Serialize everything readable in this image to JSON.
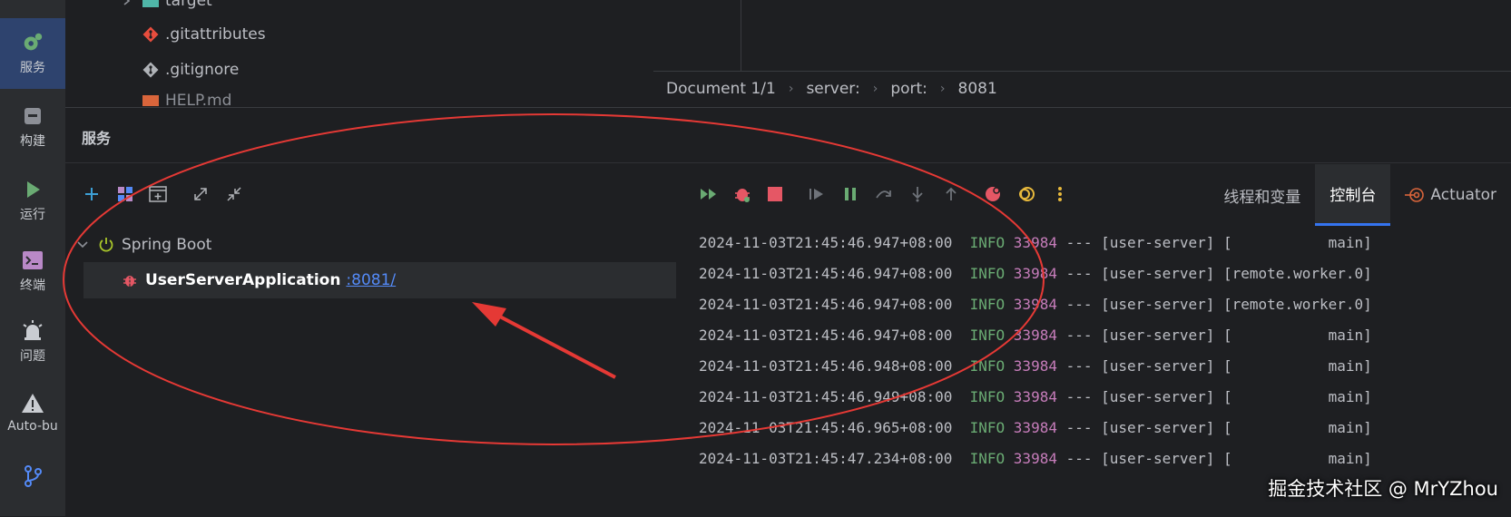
{
  "left_strip": [
    {
      "label": "服务",
      "icon": "gear-icon",
      "active": true
    },
    {
      "label": "构建",
      "icon": "build-icon"
    },
    {
      "label": "运行",
      "icon": "run-icon"
    },
    {
      "label": "终端",
      "icon": "terminal-icon"
    },
    {
      "label": "问题",
      "icon": "problems-icon"
    },
    {
      "label": "Auto-bu",
      "icon": "warning-icon"
    },
    {
      "label": "",
      "icon": "git-branch-icon"
    }
  ],
  "project_tree": [
    {
      "label": "target",
      "icon": "folder-icon"
    },
    {
      "label": ".gitattributes",
      "icon": "git-icon"
    },
    {
      "label": ".gitignore",
      "icon": "git-icon"
    },
    {
      "label": "HELP.md",
      "icon": "markdown-icon"
    }
  ],
  "breadcrumb": [
    "Document 1/1",
    "server:",
    "port:",
    "8081"
  ],
  "services": {
    "title": "服务",
    "root": "Spring Boot",
    "child_name": "UserServerApplication",
    "child_port": ":8081/"
  },
  "tabs": [
    "线程和变量",
    "控制台",
    "Actuator"
  ],
  "console_lines": [
    {
      "ts": "2024-11-03T21:45:46.947+08:00",
      "level": "INFO",
      "pid": "33984",
      "rest": "--- [user-server] [           main]"
    },
    {
      "ts": "2024-11-03T21:45:46.947+08:00",
      "level": "INFO",
      "pid": "33984",
      "rest": "--- [user-server] [remote.worker.0]"
    },
    {
      "ts": "2024-11-03T21:45:46.947+08:00",
      "level": "INFO",
      "pid": "33984",
      "rest": "--- [user-server] [remote.worker.0]"
    },
    {
      "ts": "2024-11-03T21:45:46.947+08:00",
      "level": "INFO",
      "pid": "33984",
      "rest": "--- [user-server] [           main]"
    },
    {
      "ts": "2024-11-03T21:45:46.948+08:00",
      "level": "INFO",
      "pid": "33984",
      "rest": "--- [user-server] [           main]"
    },
    {
      "ts": "2024-11-03T21:45:46.949+08:00",
      "level": "INFO",
      "pid": "33984",
      "rest": "--- [user-server] [           main]"
    },
    {
      "ts": "2024-11-03T21:45:46.965+08:00",
      "level": "INFO",
      "pid": "33984",
      "rest": "--- [user-server] [           main]"
    },
    {
      "ts": "2024-11-03T21:45:47.234+08:00",
      "level": "INFO",
      "pid": "33984",
      "rest": "--- [user-server] [           main]"
    }
  ],
  "watermark": "掘金技术社区 @ MrYZhou",
  "colors": {
    "accent": "#3574f0",
    "annotation": "#e53935",
    "info": "#6aab73",
    "pid": "#c77dbb"
  }
}
